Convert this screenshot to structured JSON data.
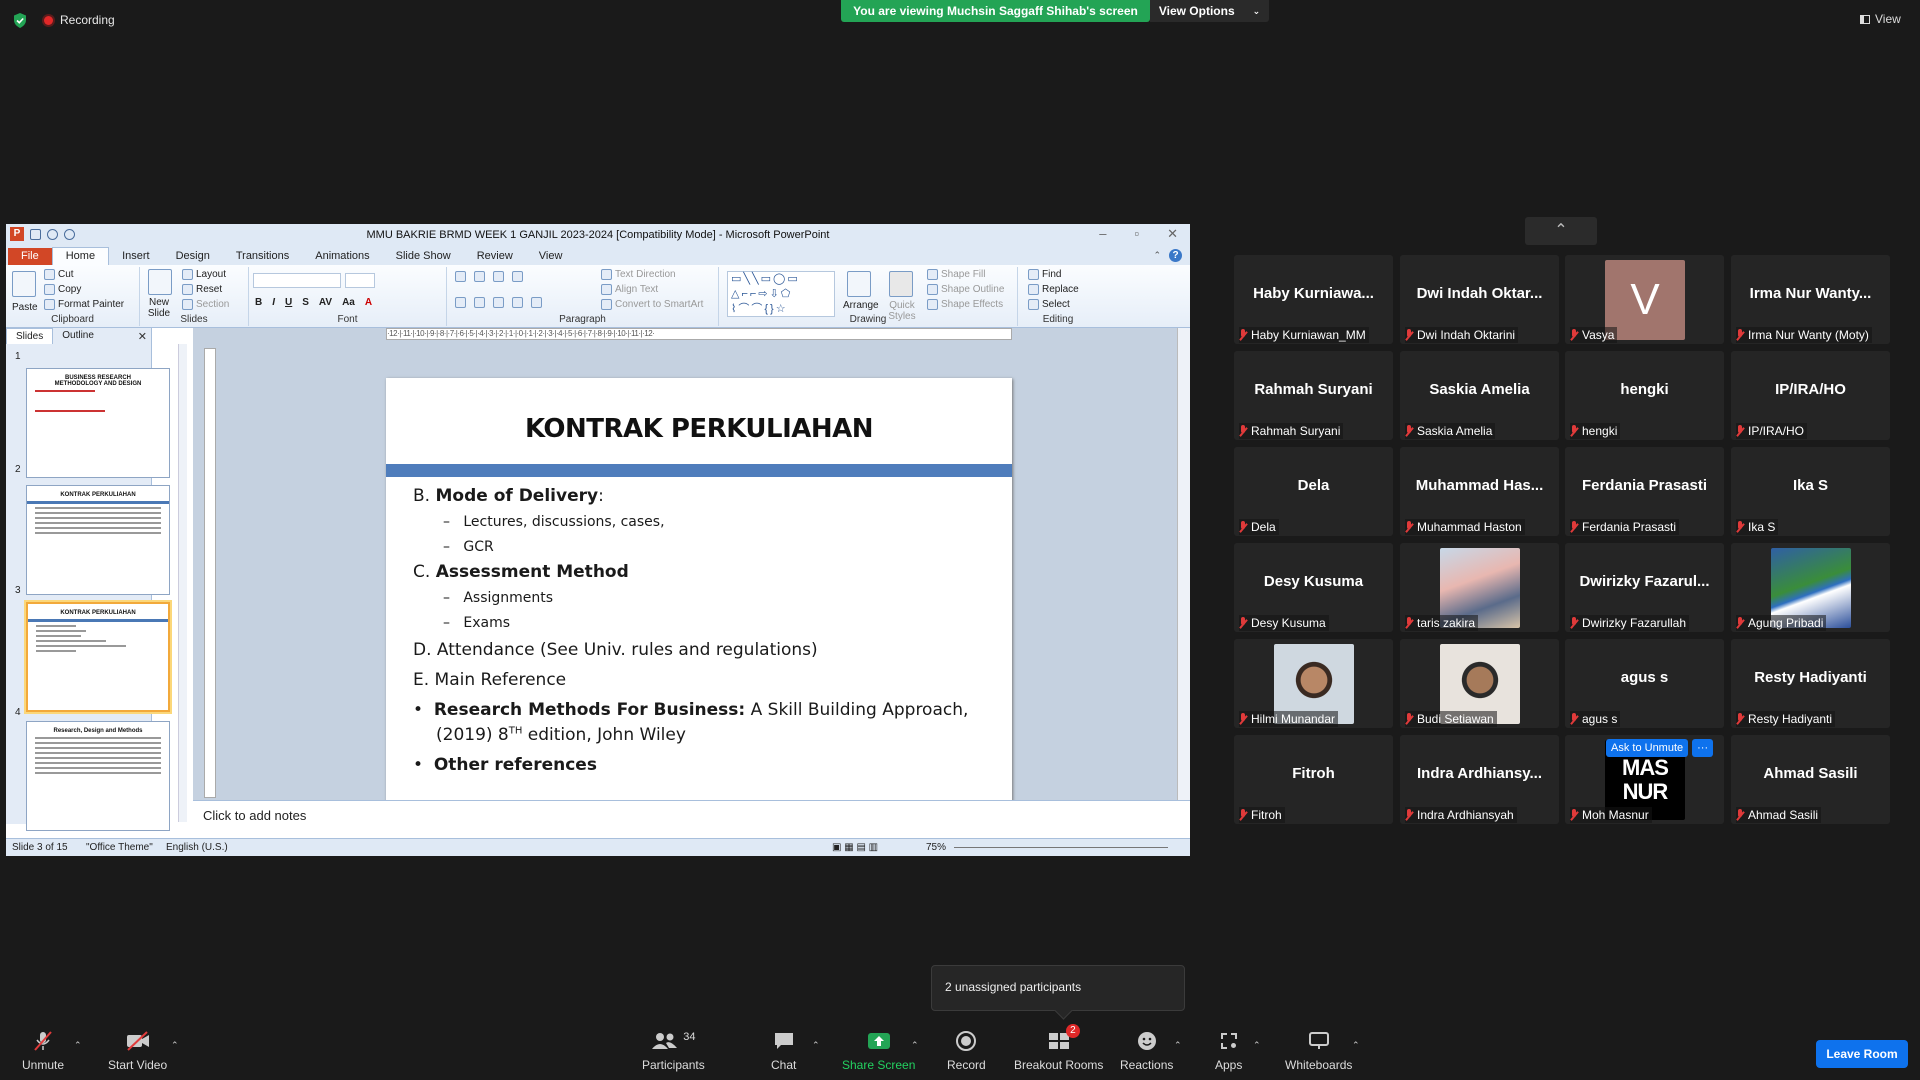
{
  "top": {
    "recording": "Recording",
    "banner": "You are viewing Muchsin Saggaff Shihab's screen",
    "view_options": "View Options",
    "view": "View"
  },
  "ppt": {
    "title": "MMU BAKRIE  BRMD WEEK 1 GANJIL 2023-2024 [Compatibility Mode] - Microsoft PowerPoint",
    "tabs": [
      "File",
      "Home",
      "Insert",
      "Design",
      "Transitions",
      "Animations",
      "Slide Show",
      "Review",
      "View"
    ],
    "ribbon": {
      "clipboard": {
        "paste": "Paste",
        "cut": "Cut",
        "copy": "Copy",
        "format_painter": "Format Painter",
        "label": "Clipboard"
      },
      "slides": {
        "new_slide": "New Slide",
        "layout": "Layout",
        "reset": "Reset",
        "section": "Section",
        "label": "Slides"
      },
      "font": {
        "label": "Font"
      },
      "paragraph": {
        "text_direction": "Text Direction",
        "align_text": "Align Text",
        "convert": "Convert to SmartArt",
        "label": "Paragraph"
      },
      "drawing": {
        "arrange": "Arrange",
        "quick_styles": "Quick Styles",
        "shape_fill": "Shape Fill",
        "shape_outline": "Shape Outline",
        "shape_effects": "Shape Effects",
        "label": "Drawing"
      },
      "editing": {
        "find": "Find",
        "replace": "Replace",
        "select": "Select",
        "label": "Editing"
      }
    },
    "panel_tabs": [
      "Slides",
      "Outline"
    ],
    "thumbnails": [
      {
        "num": "1",
        "title": "BUSINESS RESEARCH METHODOLOGY AND DESIGN"
      },
      {
        "num": "2",
        "title": "KONTRAK PERKULIAHAN"
      },
      {
        "num": "3",
        "title": "KONTRAK PERKULIAHAN"
      },
      {
        "num": "4",
        "title": "Research, Design and Methods"
      }
    ],
    "ruler": "·12·|·11·|·10·|·9·|·8·|·7·|·6·|·5·|·4·|·3·|·2·|·1·|·0·|·1·|·2·|·3·|·4·|·5·|·6·|·7·|·8·|·9·|·10·|·11·|·12·",
    "slide": {
      "title": "KONTRAK PERKULIAHAN",
      "b_prefix": "B. ",
      "b_bold": "Mode of Delivery",
      "b_colon": ":",
      "b1": "Lectures, discussions, cases,",
      "b2": "GCR",
      "c_prefix": "C. ",
      "c_bold": "Assessment Method",
      "c1": "Assignments",
      "c2": "Exams",
      "d": "D. Attendance (See Univ. rules and regulations)",
      "e": "E. Main Reference",
      "ref_bold": "Research Methods For Business:",
      "ref_rest": " A Skill Building Approach,",
      "ref_line2a": "(2019) 8",
      "ref_sup": "TH",
      "ref_line2b": " edition, John Wiley",
      "other": "Other references",
      "dash": "–",
      "bullet": "•"
    },
    "notes": "Click to add notes",
    "status": {
      "slide": "Slide 3 of 15",
      "theme": "\"Office Theme\"",
      "lang": "English (U.S.)",
      "zoom": "75%"
    }
  },
  "gallery": {
    "tiles": [
      {
        "name": "Haby  Kurniawa...",
        "label": "Haby Kurniawan_MM"
      },
      {
        "name": "Dwi  Indah  Oktar...",
        "label": "Dwi Indah Oktarini"
      },
      {
        "name": "",
        "label": "Vasya",
        "letter": "V"
      },
      {
        "name": "Irma  Nur  Wanty...",
        "label": "Irma Nur Wanty (Moty)"
      },
      {
        "name": "Rahmah Suryani",
        "label": "Rahmah Suryani"
      },
      {
        "name": "Saskia Amelia",
        "label": "Saskia Amelia"
      },
      {
        "name": "hengki",
        "label": "hengki"
      },
      {
        "name": "IP/IRA/HO",
        "label": "IP/IRA/HO"
      },
      {
        "name": "Dela",
        "label": "Dela"
      },
      {
        "name": "Muhammad  Has...",
        "label": "Muhammad Haston"
      },
      {
        "name": "Ferdania Prasasti",
        "label": "Ferdania Prasasti"
      },
      {
        "name": "Ika S",
        "label": "Ika S"
      },
      {
        "name": "Desy Kusuma",
        "label": "Desy Kusuma"
      },
      {
        "name": "",
        "label": "taris zakira"
      },
      {
        "name": "Dwirizky  Fazarul...",
        "label": "Dwirizky Fazarullah"
      },
      {
        "name": "",
        "label": "Agung Pribadi"
      },
      {
        "name": "",
        "label": "Hilmi Munandar"
      },
      {
        "name": "",
        "label": "Budi Setiawan"
      },
      {
        "name": "agus s",
        "label": "agus s"
      },
      {
        "name": "Resty Hadiyanti",
        "label": "Resty Hadiyanti"
      },
      {
        "name": "Fitroh",
        "label": "Fitroh"
      },
      {
        "name": "Indra  Ardhiansy...",
        "label": "Indra Ardhiansyah"
      },
      {
        "name": "",
        "label": "Moh Masnur",
        "logo": "MAS NUR"
      },
      {
        "name": "Ahmad Sasili",
        "label": "Ahmad Sasili"
      }
    ],
    "ask_to_unmute": "Ask to Unmute",
    "more": "···"
  },
  "unassigned": "2 unassigned participants",
  "toolbar": {
    "unmute": "Unmute",
    "start_video": "Start Video",
    "participants": "Participants",
    "participants_count": "34",
    "chat": "Chat",
    "share": "Share Screen",
    "record": "Record",
    "breakout": "Breakout Rooms",
    "breakout_badge": "2",
    "reactions": "Reactions",
    "apps": "Apps",
    "whiteboards": "Whiteboards",
    "leave": "Leave Room"
  },
  "colors": {
    "share_green": "#23a455",
    "zoom_blue": "#0e72ed",
    "ppt_file": "#d24726",
    "slide_bar": "#4f7dbc",
    "mute_red": "#e03a3a"
  }
}
